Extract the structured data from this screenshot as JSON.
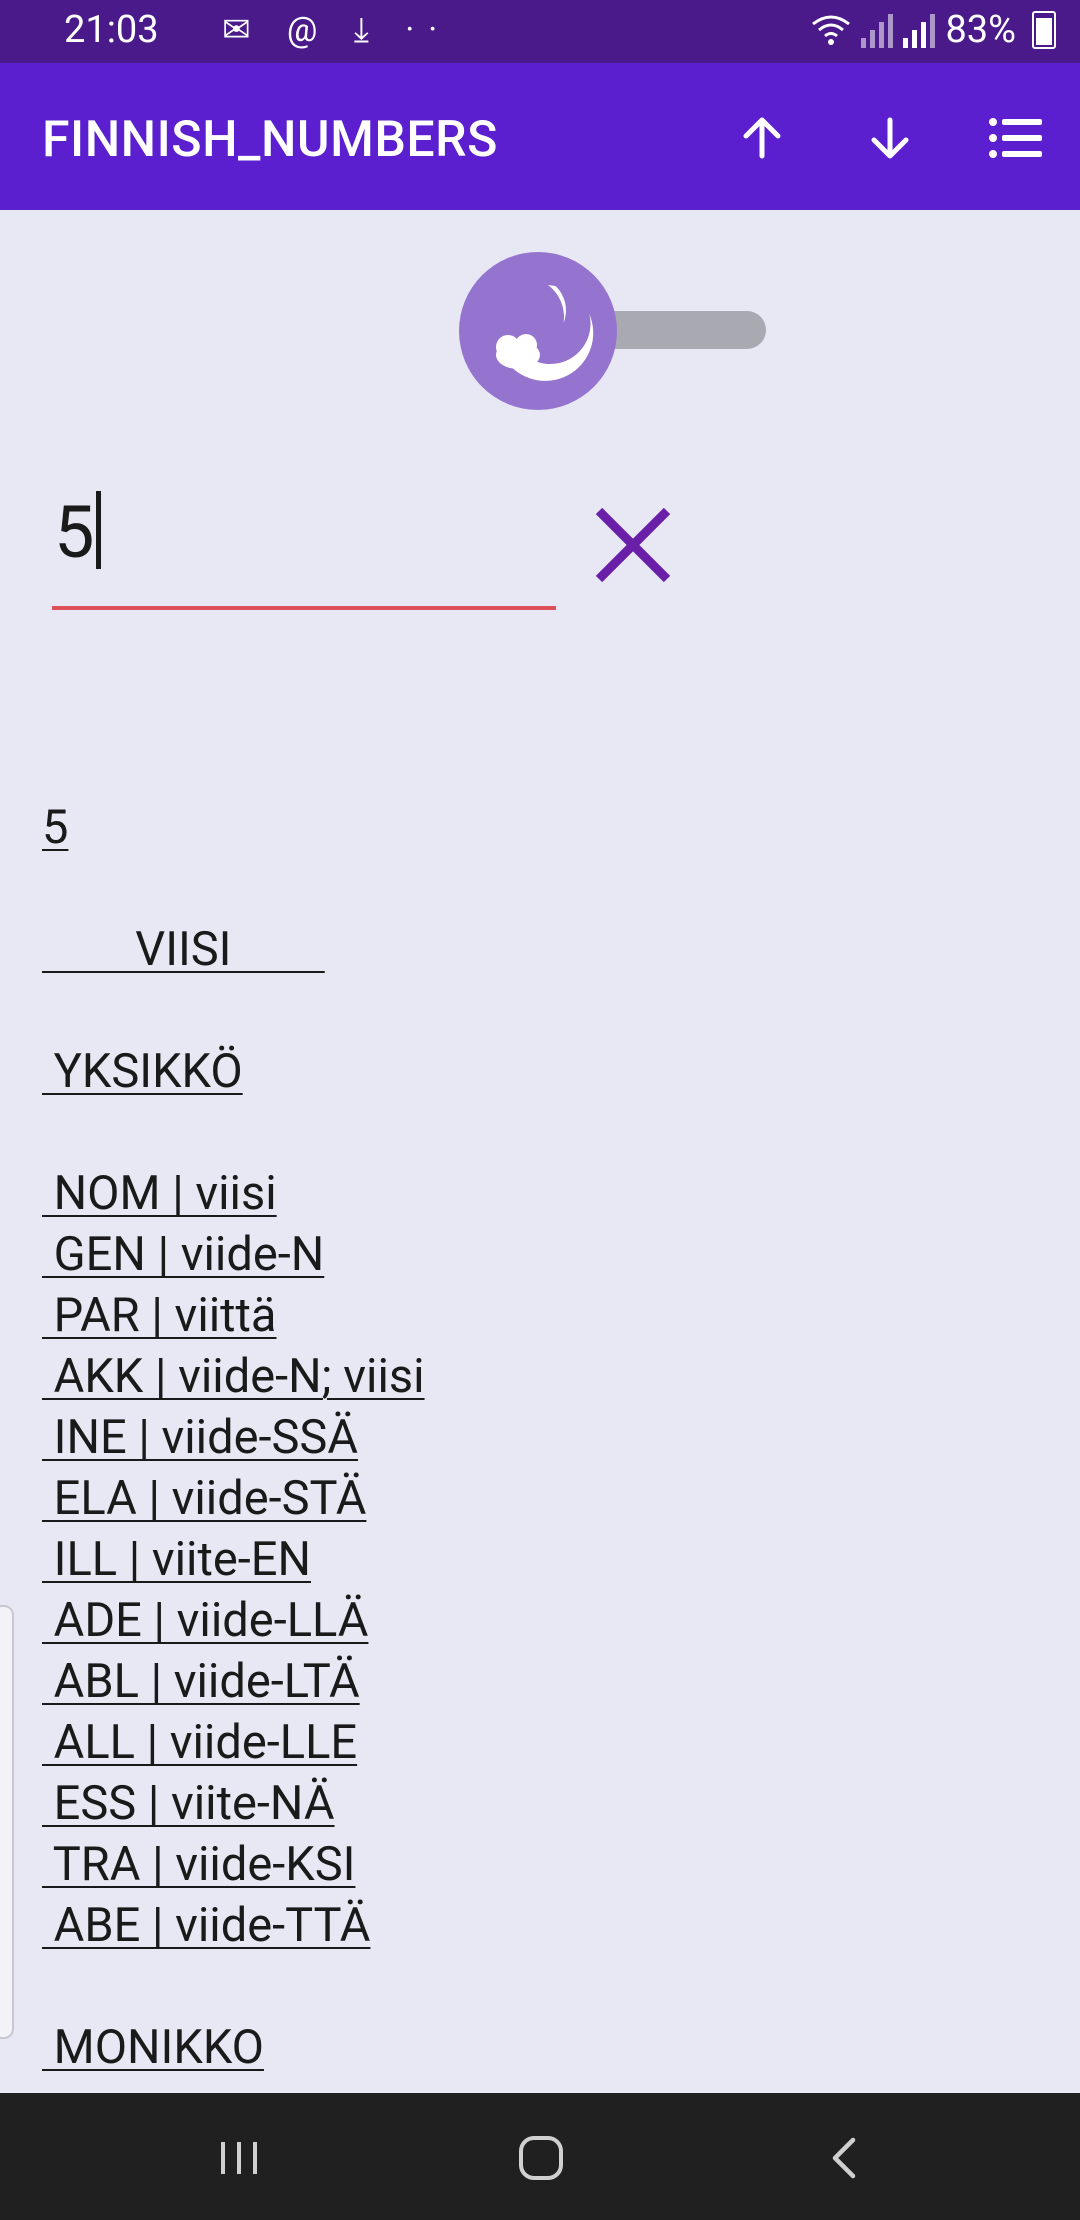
{
  "status_bar": {
    "time": "21:03",
    "notification_icons": "✉ @ ⤓ ··",
    "battery": "83%"
  },
  "app_bar": {
    "title": "FINNISH_NUMBERS",
    "icons": [
      "arrow-up-icon",
      "arrow-down-icon",
      "list-menu-icon"
    ]
  },
  "theme_toggle": {
    "icon": "moon-icon",
    "state": "dark-mode-off"
  },
  "input": {
    "value": "5"
  },
  "result": {
    "number": "5",
    "word": "        VIISI        ",
    "singular_heading": " YKSIKKÖ",
    "singular_cases": [
      " NOM | viisi",
      " GEN | viide-N",
      " PAR | viittä",
      " AKK | viide-N; viisi",
      " INE | viide-SSÄ",
      " ELA | viide-STÄ",
      " ILL | viite-EN",
      " ADE | viide-LLÄ",
      " ABL | viide-LTÄ",
      " ALL | viide-LLE",
      " ESS | viite-NÄ",
      " TRA | viide-KSI",
      " ABE | viide-TTÄ"
    ],
    "plural_heading": " MONIKKO"
  }
}
